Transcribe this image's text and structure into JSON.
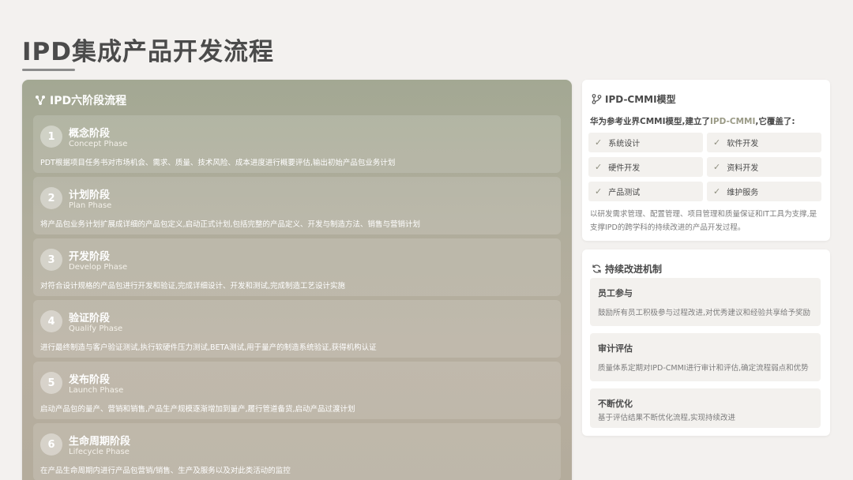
{
  "page": {
    "title": "IPD集成产品开发流程"
  },
  "left": {
    "header": "IPD六阶段流程",
    "phases": [
      {
        "num": "1",
        "name": "概念阶段",
        "en": "Concept Phase",
        "desc": "PDT根据项目任务书对市场机会、需求、质量、技术风险、成本进度进行概要评估,输出初始产品包业务计划"
      },
      {
        "num": "2",
        "name": "计划阶段",
        "en": "Plan Phase",
        "desc": "将产品包业务计划扩展成详细的产品包定义,启动正式计划,包括完整的产品定义、开发与制造方法、销售与营销计划"
      },
      {
        "num": "3",
        "name": "开发阶段",
        "en": "Develop Phase",
        "desc": "对符合设计规格的产品包进行开发和验证,完成详细设计、开发和测试,完成制造工艺设计实施"
      },
      {
        "num": "4",
        "name": "验证阶段",
        "en": "Qualify Phase",
        "desc": "进行最终制造与客户验证测试,执行软硬件压力测试,BETA测试,用于量产的制造系统验证,获得机构认证"
      },
      {
        "num": "5",
        "name": "发布阶段",
        "en": "Launch Phase",
        "desc": "启动产品包的量产、营销和销售,产品生产规模逐渐增加到量产,履行管道备货,启动产品过渡计划"
      },
      {
        "num": "6",
        "name": "生命周期阶段",
        "en": "Lifecycle Phase",
        "desc": "在产品生命周期内进行产品包营销/销售、生产及服务以及对此类活动的监控"
      }
    ]
  },
  "cmmi": {
    "header": "IPD-CMMI模型",
    "intro_prefix": "华为参考业界CMMI模型,建立了",
    "intro_highlight": "IPD-CMMI",
    "intro_suffix": ",它覆盖了:",
    "features": [
      "系统设计",
      "软件开发",
      "硬件开发",
      "资料开发",
      "产品测试",
      "维护服务"
    ],
    "check": "✓",
    "footer": "以研发需求管理、配置管理、项目管理和质量保证和IT工具为支撑,是支撑IPD的跨学科的持续改进的产品开发过程。"
  },
  "improve": {
    "header": "持续改进机制",
    "items": [
      {
        "title": "员工参与",
        "desc": "鼓励所有员工积极参与过程改进,对优秀建议和经验共享给予奖励"
      },
      {
        "title": "审计评估",
        "desc": "质量体系定期对IPD-CMMI进行审计和评估,确定流程弱点和优势"
      },
      {
        "title": "不断优化",
        "desc": "基于评估结果不断优化流程,实现持续改进"
      }
    ]
  },
  "colors": {
    "panel": "#a3a893",
    "highlight": "#9a9a86",
    "card_bg": "#ffffff"
  }
}
